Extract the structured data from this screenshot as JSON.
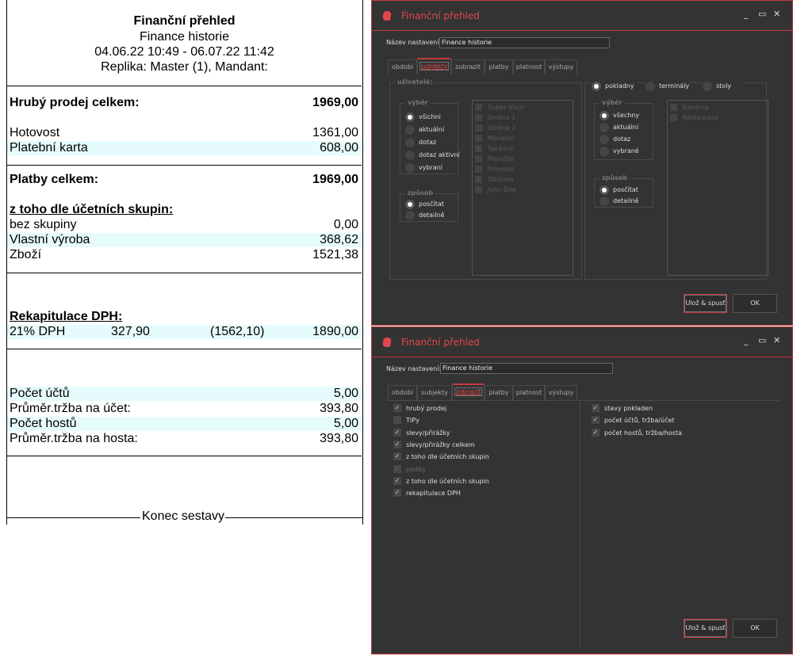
{
  "report": {
    "title": "Finanční přehled",
    "subtitle": "Finance historie",
    "period": "04.06.22 10:49 - 06.07.22 11:42",
    "replica": "Replika: Master (1), Mandant:",
    "gross_label": "Hrubý prodej celkem:",
    "gross_value": "1969,00",
    "payments": [
      {
        "label": "Hotovost",
        "value": "1361,00"
      },
      {
        "label": "Platební karta",
        "value": "608,00"
      }
    ],
    "payments_total_label": "Platby celkem:",
    "payments_total_value": "1969,00",
    "groups_heading": "z toho dle účetních skupin:",
    "groups": [
      {
        "label": "bez skupiny",
        "value": "0,00"
      },
      {
        "label": "Vlastní výroba",
        "value": "368,62"
      },
      {
        "label": "Zboží",
        "value": "1521,38"
      }
    ],
    "vat_heading": "Rekapitulace DPH:",
    "vat_row": {
      "label": "21% DPH",
      "tax": "327,90",
      "base": "(1562,10)",
      "total": "1890,00"
    },
    "stats": [
      {
        "label": "Počet účtů",
        "value": "5,00"
      },
      {
        "label": "Průměr.tržba na účet:",
        "value": "393,80"
      },
      {
        "label": "Počet hostů",
        "value": "5,00"
      },
      {
        "label": "Průměr.tržba na hosta:",
        "value": "393,80"
      }
    ],
    "end": "Konec sestavy"
  },
  "dialog": {
    "title": "Finanční přehled",
    "name_label": "Název nastavení:",
    "name_value": "Finance historie",
    "tabs": [
      "období",
      "subjekty",
      "zobrazit",
      "platby",
      "platnost",
      "výstupy"
    ],
    "save_run": "Ulož & spusť",
    "ok": "OK"
  },
  "subjects": {
    "users_label": "uživatelé:",
    "vyber_label": "výběr",
    "users_vyber": [
      "všichni",
      "aktuální",
      "dotaz",
      "dotaz aktivní",
      "vybraní"
    ],
    "zpusob_label": "způsob",
    "zpusob": [
      "posčítat",
      "detailně"
    ],
    "users": [
      "Super Visor",
      "Směna 1",
      "Směna 2",
      "Manažer",
      "Správce",
      "Manažer",
      "Provozní",
      "Obsluha",
      "John Doe"
    ],
    "source": [
      "pokladny",
      "terminály",
      "stoly"
    ],
    "pos_vyber": [
      "všechny",
      "aktuální",
      "dotaz",
      "vybrané"
    ],
    "pos": [
      "Kavárna",
      "Restaurace"
    ]
  },
  "display": {
    "left": [
      {
        "label": "hrubý prodej",
        "checked": true
      },
      {
        "label": "TIPy",
        "checked": false
      },
      {
        "label": "slevy/přirážky",
        "checked": true
      },
      {
        "label": "slevy/přirážky celkem",
        "checked": true
      },
      {
        "label": "z toho dle účetních skupin",
        "checked": true
      },
      {
        "label": "platby",
        "checked": true,
        "disabled": true
      },
      {
        "label": "z toho dle účetních skupin",
        "checked": true
      },
      {
        "label": "rekapitulace DPH",
        "checked": true
      }
    ],
    "right": [
      {
        "label": "stavy pokladen",
        "checked": true
      },
      {
        "label": "počet účtů, tržba/účet",
        "checked": true
      },
      {
        "label": "počet hostů, tržba/hosta",
        "checked": true
      }
    ]
  }
}
